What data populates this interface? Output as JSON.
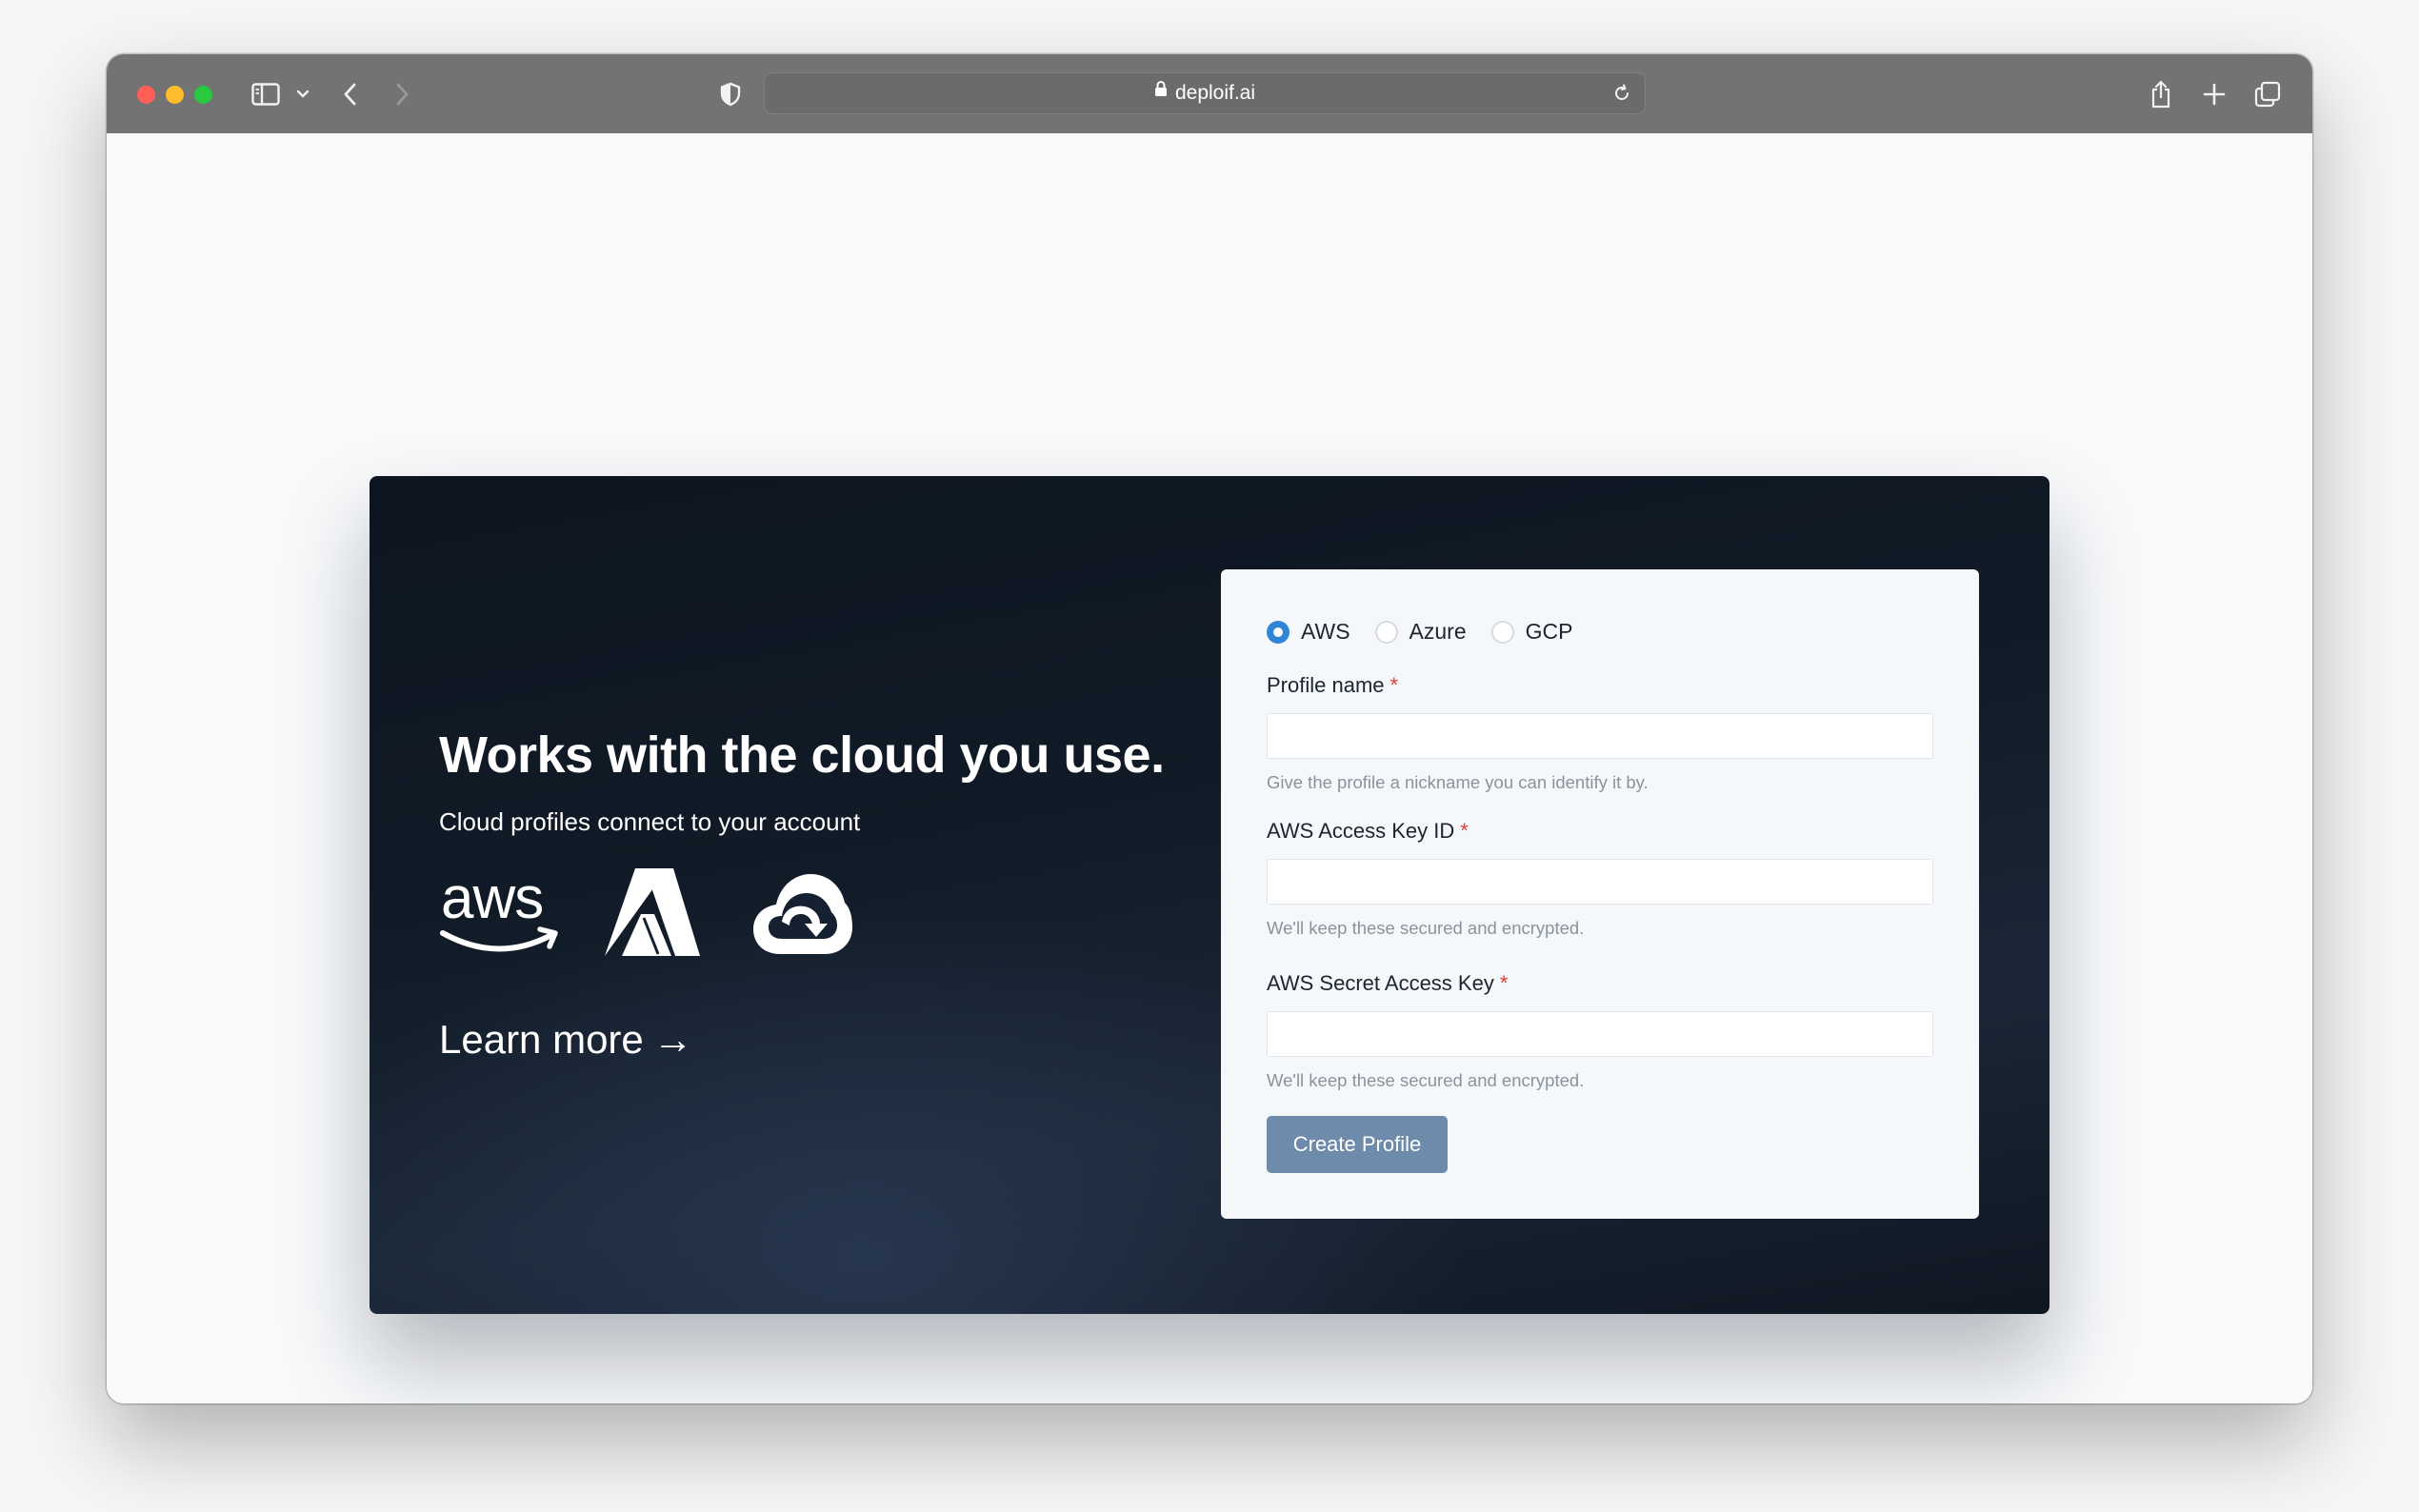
{
  "browser": {
    "url": "deploif.ai"
  },
  "hero": {
    "heading": "Works with the cloud you use.",
    "subheading": "Cloud profiles connect to your account",
    "logo_text_aws": "aws",
    "learn_more": "Learn more",
    "learn_more_arrow": "→"
  },
  "form": {
    "providers": [
      {
        "label": "AWS",
        "selected": true
      },
      {
        "label": "Azure",
        "selected": false
      },
      {
        "label": "GCP",
        "selected": false
      }
    ],
    "profile_name": {
      "label": "Profile name",
      "required_mark": "*",
      "value": "",
      "help": "Give the profile a nickname you can identify it by."
    },
    "access_key_id": {
      "label": "AWS Access Key ID",
      "required_mark": "*",
      "value": "",
      "help": "We'll keep these secured and encrypted."
    },
    "secret_access_key": {
      "label": "AWS Secret Access Key",
      "required_mark": "*",
      "value": "",
      "help": "We'll keep these secured and encrypted."
    },
    "submit_label": "Create Profile"
  },
  "colors": {
    "accent_radio": "#2f86d6",
    "button": "#6f8bab",
    "required": "#d9413b",
    "hero_bg": "#111b27"
  },
  "icons": [
    "sidebar-icon",
    "chevron-down-icon",
    "back-icon",
    "forward-icon",
    "shield-icon",
    "lock-icon",
    "reload-icon",
    "share-icon",
    "plus-icon",
    "tabs-icon",
    "aws-logo",
    "azure-logo",
    "gcp-logo",
    "arrow-right-icon"
  ]
}
